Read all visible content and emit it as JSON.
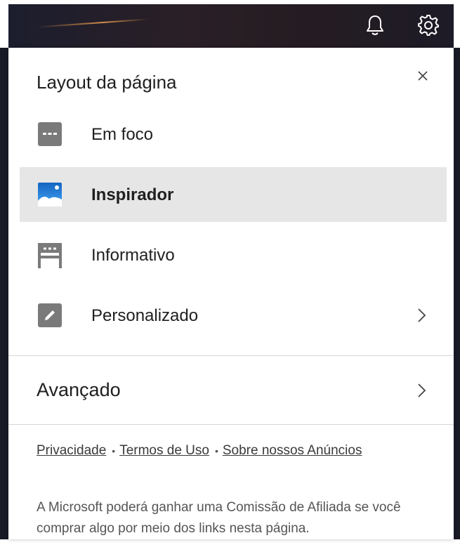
{
  "topbar": {
    "icons": [
      "bell-icon",
      "gear-icon"
    ]
  },
  "panel": {
    "title": "Layout da página",
    "close_icon": "close-icon",
    "close_glyph": "×"
  },
  "layouts": [
    {
      "label": "Em foco",
      "icon": "focus-layout-icon",
      "selected": false
    },
    {
      "label": "Inspirador",
      "icon": "inspirational-layout-icon",
      "selected": true
    },
    {
      "label": "Informativo",
      "icon": "informational-layout-icon",
      "selected": false
    },
    {
      "label": "Personalizado",
      "icon": "custom-layout-icon",
      "selected": false,
      "has_submenu": true
    }
  ],
  "advanced": {
    "label": "Avançado",
    "has_submenu": true
  },
  "footer": {
    "links": [
      {
        "label": "Privacidade"
      },
      {
        "label": "Termos de Uso"
      },
      {
        "label": "Sobre nossos Anúncios"
      }
    ],
    "separator": "•",
    "disclaimer": "A Microsoft poderá ganhar uma Comissão de Afiliada se você comprar algo por meio dos links nesta página."
  },
  "colors": {
    "selected_bg": "#e6e6e6",
    "icon_gray": "#7a7a7a",
    "accent_blue": "#1e88e5"
  }
}
